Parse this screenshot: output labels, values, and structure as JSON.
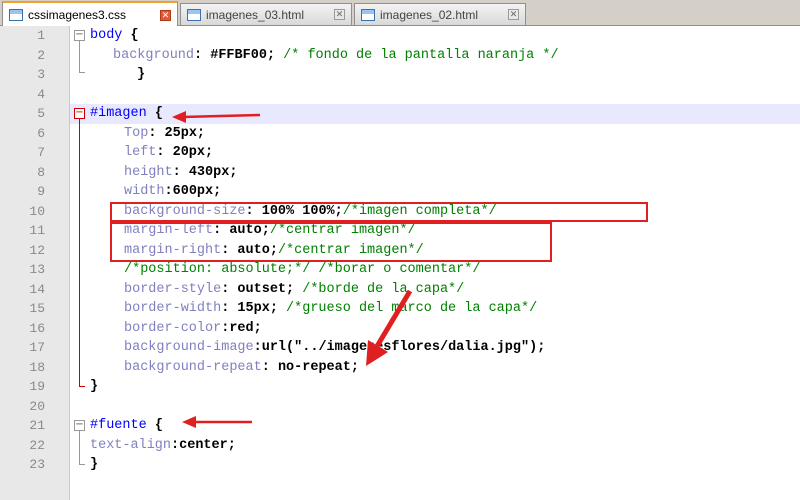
{
  "tabs": [
    {
      "label": "cssimagenes3.css",
      "active": true
    },
    {
      "label": "imagenes_03.html",
      "active": false
    },
    {
      "label": "imagenes_02.html",
      "active": false
    }
  ],
  "line_numbers": [
    "1",
    "2",
    "3",
    "4",
    "5",
    "6",
    "7",
    "8",
    "9",
    "10",
    "11",
    "12",
    "13",
    "14",
    "15",
    "16",
    "17",
    "18",
    "19",
    "20",
    "21",
    "22",
    "23"
  ],
  "code": {
    "l1": {
      "sel": "body",
      "brace": " {"
    },
    "l2": {
      "prop": "background",
      "colon": ": ",
      "val": "#FFBF00",
      "semi": "; ",
      "cmt": "/* fondo de la pantalla naranja */"
    },
    "l3": {
      "brace": "}"
    },
    "l5": {
      "sel": "#imagen",
      "brace": " {"
    },
    "l6": {
      "prop": "Top",
      "colon": ": ",
      "val": "25px",
      "semi": ";"
    },
    "l7": {
      "prop": "left",
      "colon": ": ",
      "val": "20px",
      "semi": ";"
    },
    "l8": {
      "prop": "height",
      "colon": ": ",
      "val": "430px",
      "semi": ";"
    },
    "l9": {
      "prop": "width",
      "colon": ":",
      "val": "600px",
      "semi": ";"
    },
    "l10": {
      "prop": "background-size",
      "colon": ": ",
      "val": "100% 100%",
      "semi": ";",
      "cmt": "/*imagen completa*/"
    },
    "l11": {
      "prop": "margin-left",
      "colon": ": ",
      "val": "auto",
      "semi": ";",
      "cmt": "/*centrar imagen*/"
    },
    "l12": {
      "prop": "margin-right",
      "colon": ": ",
      "val": "auto",
      "semi": ";",
      "cmt": "/*centrar imagen*/"
    },
    "l13": {
      "cmt": "/*position: absolute;*/ /*borar o comentar*/"
    },
    "l14": {
      "prop": "border-style",
      "colon": ": ",
      "val": "outset",
      "semi": "; ",
      "cmt": "/*borde de la capa*/"
    },
    "l15": {
      "prop": "border-width",
      "colon": ": ",
      "val": "15px",
      "semi": "; ",
      "cmt": "/*grueso del marco de la capa*/"
    },
    "l16": {
      "prop": "border-color",
      "colon": ":",
      "val": "red",
      "semi": ";"
    },
    "l17": {
      "prop": "background-image",
      "colon": ":",
      "val": "url(\"../imagenesflores/dalia.jpg\")",
      "semi": ";"
    },
    "l18": {
      "prop": "background-repeat",
      "colon": ": ",
      "val": "no-repeat",
      "semi": ";"
    },
    "l19": {
      "brace": "}"
    },
    "l21": {
      "sel": "#fuente",
      "brace": " {"
    },
    "l22": {
      "prop": "text-align",
      "colon": ":",
      "val": "center",
      "semi": ";"
    },
    "l23": {
      "brace": "}"
    }
  },
  "colors": {
    "selector": "#0000ff",
    "property": "#8080c0",
    "comment": "#008000",
    "annotation": "#e02020",
    "active_tab_accent": "#f0a030"
  }
}
